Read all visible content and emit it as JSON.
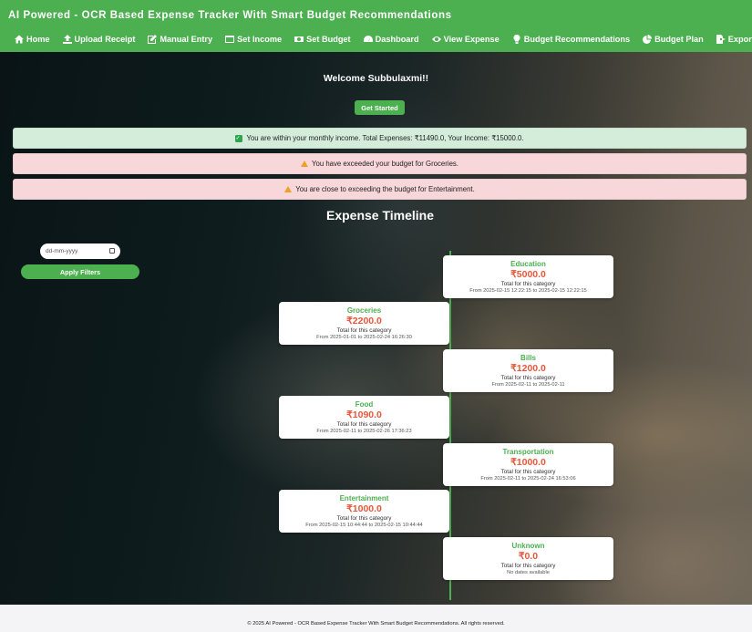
{
  "app": {
    "title": "AI Powered - OCR Based Expense Tracker With Smart Budget Recommendations"
  },
  "nav": [
    {
      "label": "Home",
      "icon": "home-icon"
    },
    {
      "label": "Upload Receipt",
      "icon": "upload-icon"
    },
    {
      "label": "Manual Entry",
      "icon": "edit-icon"
    },
    {
      "label": "Set Income",
      "icon": "wallet-icon"
    },
    {
      "label": "Set Budget",
      "icon": "money-icon"
    },
    {
      "label": "Dashboard",
      "icon": "gauge-icon"
    },
    {
      "label": "View Expense",
      "icon": "eye-icon"
    },
    {
      "label": "Budget Recommendations",
      "icon": "lightbulb-icon"
    },
    {
      "label": "Budget Plan",
      "icon": "pie-chart-icon"
    },
    {
      "label": "Export Data",
      "icon": "export-icon"
    }
  ],
  "welcome": {
    "text": "Welcome Subbulaxmi!!",
    "button": "Get Started"
  },
  "alerts": [
    {
      "type": "success",
      "text": "You are within your monthly income. Total Expenses: ₹11490.0, Your Income: ₹15000.0."
    },
    {
      "type": "warning",
      "text": "You have exceeded your budget for Groceries."
    },
    {
      "type": "warning",
      "text": "You are close to exceeding the budget for Entertainment."
    }
  ],
  "timeline": {
    "title": "Expense Timeline",
    "date_placeholder": "dd-mm-yyyy",
    "apply_label": "Apply Filters",
    "cards": [
      {
        "category": "Education",
        "amount": "₹5000.0",
        "subtitle": "Total for this category",
        "range": "From 2025-02-15 12:22:15 to 2025-02-15 12:22:15"
      },
      {
        "category": "Groceries",
        "amount": "₹2200.0",
        "subtitle": "Total for this category",
        "range": "From 2025-01-01 to 2025-02-24 16:26:30"
      },
      {
        "category": "Bills",
        "amount": "₹1200.0",
        "subtitle": "Total for this category",
        "range": "From 2025-02-11 to 2025-02-11"
      },
      {
        "category": "Food",
        "amount": "₹1090.0",
        "subtitle": "Total for this category",
        "range": "From 2025-02-11 to 2025-02-26 17:36:23"
      },
      {
        "category": "Transportation",
        "amount": "₹1000.0",
        "subtitle": "Total for this category",
        "range": "From 2025-02-11 to 2025-02-24 16:53:06"
      },
      {
        "category": "Entertainment",
        "amount": "₹1000.0",
        "subtitle": "Total for this category",
        "range": "From 2025-02-15 10:44:44 to 2025-02-15 10:44:44"
      },
      {
        "category": "Unknown",
        "amount": "₹0.0",
        "subtitle": "Total for this category",
        "range": "No dates available"
      }
    ]
  },
  "footer": {
    "text": "© 2025 AI Powered - OCR Based Expense Tracker With Smart Budget Recommendations. All rights reserved."
  },
  "colors": {
    "accent": "#4caf50",
    "amount": "#e8573a",
    "success_bg": "#d4edda",
    "warning_bg": "#f8d7da"
  }
}
